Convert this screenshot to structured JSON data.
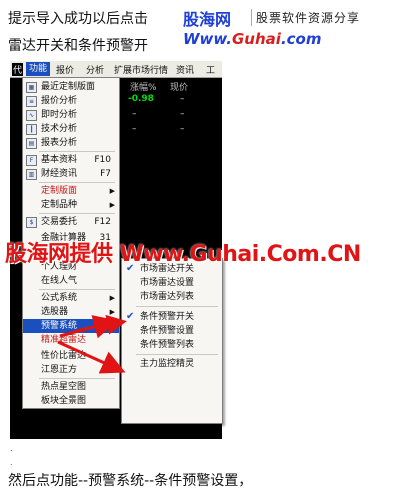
{
  "intro": {
    "line1": "提示导入成功以后点击",
    "line2": "雷达开关和条件预警开"
  },
  "banner": {
    "brand": "股海网",
    "tagline": "股票软件资源分享",
    "url_prefix": "Www.",
    "url_main": "Guhai",
    "url_suffix": ".com"
  },
  "menubar": {
    "items": [
      "功能",
      "报价",
      "分析",
      "扩展市场行情",
      "资讯",
      "工"
    ],
    "active_index": 0,
    "first_cut": "代"
  },
  "grid": {
    "col_change": "涨幅%",
    "col_price": "现价",
    "row1_change": "-0.98",
    "dash": "–"
  },
  "menu": {
    "items": [
      {
        "label": "最近定制版面",
        "icon": "layout-icon"
      },
      {
        "label": "报价分析",
        "icon": "quote-icon"
      },
      {
        "label": "即时分析",
        "icon": "chart-icon"
      },
      {
        "label": "技术分析",
        "icon": "tech-icon"
      },
      {
        "label": "报表分析",
        "icon": "report-icon"
      },
      {
        "label": "基本资料",
        "shortcut": "F10",
        "icon": "info-icon"
      },
      {
        "label": "财经资讯",
        "shortcut": "F7",
        "icon": "news-icon"
      },
      {
        "label": "定制版面",
        "red": true
      },
      {
        "label": "定制品种"
      },
      {
        "label": "交易委托",
        "shortcut": "F12",
        "icon": "trade-icon"
      },
      {
        "label": "金融计算器",
        "shortcut": "31"
      },
      {
        "label": "个人理财"
      },
      {
        "label": "在线人气"
      },
      {
        "label": "公式系统"
      },
      {
        "label": "选股器"
      },
      {
        "label": "预警系统"
      },
      {
        "label": "精准超雷达"
      },
      {
        "label": "性价比雷达"
      },
      {
        "label": "江恩正方"
      },
      {
        "label": "热点星空图"
      },
      {
        "label": "板块全景图"
      }
    ]
  },
  "submenu": {
    "items": [
      {
        "label": "市场雷达开关",
        "checked": true
      },
      {
        "label": "市场雷达设置"
      },
      {
        "label": "市场雷达列表"
      },
      {
        "label": "条件预警开关",
        "checked": true
      },
      {
        "label": "条件预警设置"
      },
      {
        "label": "条件预警列表"
      },
      {
        "label": "主力监控精灵"
      }
    ]
  },
  "watermark": "股海网提供 Www.Guhai.Com.CN",
  "outro": "然后点功能--预警系统--条件预警设置，",
  "colors": {
    "accent": "#1b4fbd",
    "red": "#e01414",
    "green": "#00e000"
  }
}
